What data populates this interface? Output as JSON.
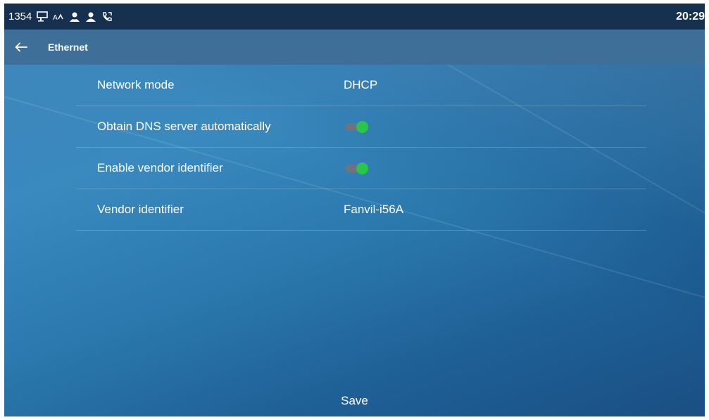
{
  "status_bar": {
    "extension": "1354",
    "time": "20:29",
    "icons": [
      "network-icon",
      "sms-icon",
      "account-icon",
      "account-icon",
      "call-forward-icon"
    ]
  },
  "header": {
    "title": "Ethernet",
    "back_icon": "back-arrow-icon"
  },
  "settings": [
    {
      "label": "Network mode",
      "type": "value",
      "value": "DHCP"
    },
    {
      "label": "Obtain DNS server automatically",
      "type": "toggle",
      "enabled": true
    },
    {
      "label": "Enable vendor identifier",
      "type": "toggle",
      "enabled": true
    },
    {
      "label": "Vendor identifier",
      "type": "value",
      "value": "Fanvil-i56A"
    }
  ],
  "footer": {
    "save_label": "Save"
  },
  "colors": {
    "status_bar": "#16304f",
    "title_bar": "#3e6f99",
    "toggle_on": "#2ac64b",
    "toggle_track": "#6d7480"
  }
}
